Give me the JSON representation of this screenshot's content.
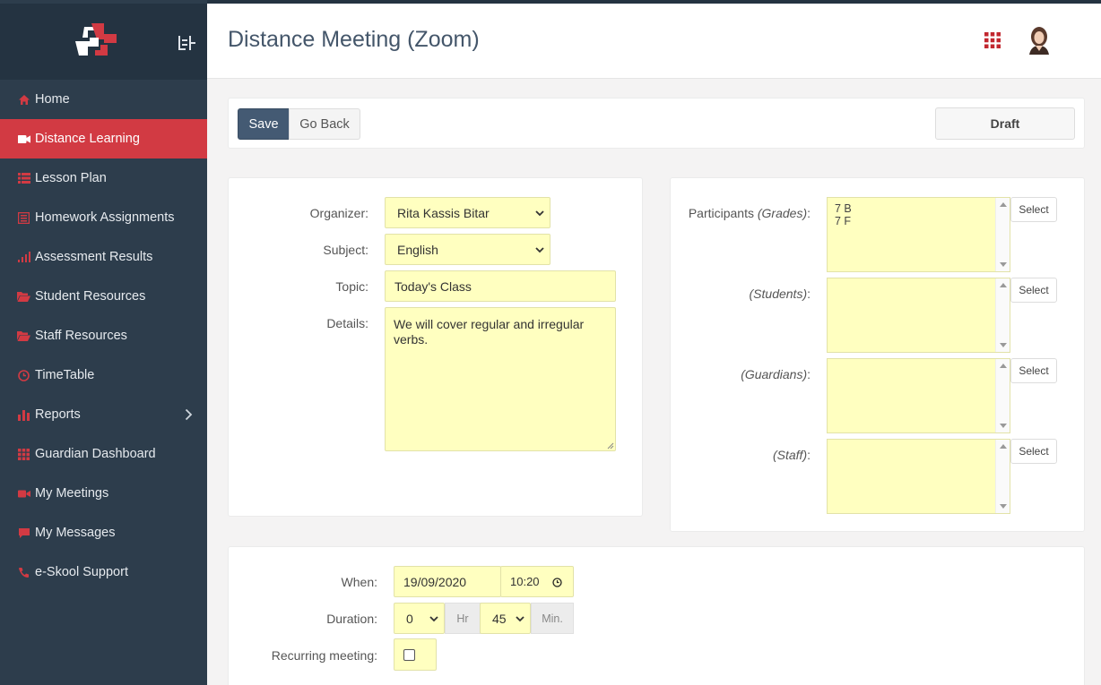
{
  "sidebar": {
    "items": [
      {
        "label": "Home",
        "icon": "home-icon",
        "active": false
      },
      {
        "label": "Distance Learning",
        "icon": "video-camera-icon",
        "active": true
      },
      {
        "label": "Lesson Plan",
        "icon": "list-icon",
        "active": false
      },
      {
        "label": "Homework Assignments",
        "icon": "document-icon",
        "active": false
      },
      {
        "label": "Assessment Results",
        "icon": "signal-bars-icon",
        "active": false
      },
      {
        "label": "Student Resources",
        "icon": "folder-open-icon",
        "active": false
      },
      {
        "label": "Staff Resources",
        "icon": "folder-open-icon",
        "active": false
      },
      {
        "label": "TimeTable",
        "icon": "clock-icon",
        "active": false
      },
      {
        "label": "Reports",
        "icon": "bar-chart-icon",
        "active": false
      },
      {
        "label": "Guardian Dashboard",
        "icon": "grid-icon",
        "active": false
      },
      {
        "label": "My Meetings",
        "icon": "video-camera-icon",
        "active": false
      },
      {
        "label": "My Messages",
        "icon": "chat-bubble-icon",
        "active": false
      },
      {
        "label": "e-Skool Support",
        "icon": "phone-icon",
        "active": false
      }
    ]
  },
  "header": {
    "title": "Distance Meeting (Zoom)"
  },
  "actions": {
    "save_label": "Save",
    "back_label": "Go Back",
    "status_label": "Draft"
  },
  "form": {
    "organizer_label": "Organizer:",
    "organizer_value": "Rita Kassis Bitar",
    "subject_label": "Subject:",
    "subject_value": "English",
    "topic_label": "Topic:",
    "topic_value": "Today's Class",
    "details_label": "Details:",
    "details_value": "We will cover regular and irregular verbs."
  },
  "participants": {
    "grades_label_prefix": "Participants ",
    "grades_label": "(Grades)",
    "grades_values": [
      "7 B",
      "7 F"
    ],
    "students_label": "(Students)",
    "guardians_label": "(Guardians)",
    "staff_label": "(Staff)",
    "select_label": "Select"
  },
  "schedule": {
    "when_label": "When:",
    "date_value": "19/09/2020",
    "time_value": "10:20",
    "duration_label": "Duration:",
    "hours_value": "0",
    "hours_unit": "Hr",
    "minutes_value": "45",
    "minutes_unit": "Min.",
    "recurring_label": "Recurring meeting:"
  },
  "colors": {
    "sidebar_bg": "#2d3d4c",
    "active_accent": "#d23a43",
    "field_bg": "#ffffc0",
    "save_button": "#445a73"
  }
}
